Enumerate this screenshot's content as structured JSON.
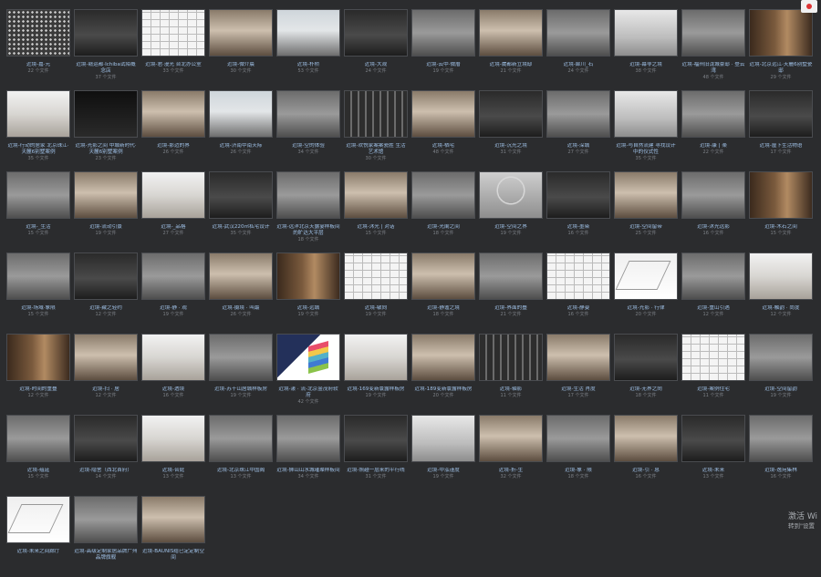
{
  "folders": [
    {
      "name": "近境-嘉·元",
      "count": "22 个文件",
      "style": "v-dots"
    },
    {
      "name": "近境-赣运都·Ichiba试陌概念店",
      "count": "37 个文件",
      "style": "v-dark"
    },
    {
      "name": "近境-君·漫光 台北办公室",
      "count": "33 个文件",
      "style": "v-plan"
    },
    {
      "name": "近境-微介晨",
      "count": "30 个文件",
      "style": "v-warm"
    },
    {
      "name": "近境-朴桥",
      "count": "53 个文件",
      "style": "v-sky"
    },
    {
      "name": "近境-大观",
      "count": "24 个文件",
      "style": "v-dark"
    },
    {
      "name": "近境-云中·微厝",
      "count": "19 个文件",
      "style": "v-grey"
    },
    {
      "name": "近境-崴都新立境邸",
      "count": "21 个文件",
      "style": "v-warm"
    },
    {
      "name": "近境-犀川_石",
      "count": "24 个文件",
      "style": "v-grey"
    },
    {
      "name": "近境-幕非之境",
      "count": "38 个文件",
      "style": "v-white"
    },
    {
      "name": "近境-福州旧泷城豪邸 · 登云湾",
      "count": "48 个文件",
      "style": "v-grey"
    },
    {
      "name": "近境-北京远江·天麓6别墅瓷邸",
      "count": "29 个文件",
      "style": "v-wood"
    },
    {
      "name": "近境-行动的居家 北京珠江·天麓6别墅案例",
      "count": "35 个文件",
      "style": "v-bright"
    },
    {
      "name": "近境-光影之间 中城新时代·天麓6别墅案例",
      "count": "23 个文件",
      "style": "v-black"
    },
    {
      "name": "近境-那边的界",
      "count": "26 个文件",
      "style": "v-warm"
    },
    {
      "name": "近境-济南中南天际",
      "count": "26 个文件",
      "style": "v-sky"
    },
    {
      "name": "近境-空的体验",
      "count": "34 个文件",
      "style": "v-grey"
    },
    {
      "name": "近境-欢悦家案案瓷胜 生活艺术馆",
      "count": "30 个文件",
      "style": "v-stripes"
    },
    {
      "name": "近境-栖宅",
      "count": "48 个文件",
      "style": "v-warm"
    },
    {
      "name": "近境-沉光之境",
      "count": "31 个文件",
      "style": "v-dark"
    },
    {
      "name": "近境-深城",
      "count": "27 个文件",
      "style": "v-grey"
    },
    {
      "name": "近境-与自然流建 寻找设计中的仪式性",
      "count": "35 个文件",
      "style": "v-white"
    },
    {
      "name": "近境-康 | 楽",
      "count": "22 个文件",
      "style": "v-grey"
    },
    {
      "name": "近境-屋下生活物语",
      "count": "17 个文件",
      "style": "v-dark"
    },
    {
      "name": "近境-_生活",
      "count": "15 个文件",
      "style": "v-grey"
    },
    {
      "name": "近境-流动引景",
      "count": "19 个文件",
      "style": "v-warm"
    },
    {
      "name": "近境-_品格",
      "count": "27 个文件",
      "style": "v-bright"
    },
    {
      "name": "近境-武汉220㎡私宅设计",
      "count": "35 个文件",
      "style": "v-dark"
    },
    {
      "name": "近境-远洋北京天露宴样板间的旷达大平层",
      "count": "18 个文件",
      "style": "v-grey"
    },
    {
      "name": "近境-沐光 | 对话",
      "count": "15 个文件",
      "style": "v-warm"
    },
    {
      "name": "近境-光阑之间",
      "count": "18 个文件",
      "style": "v-grey"
    },
    {
      "name": "近境-空间之界",
      "count": "19 个文件",
      "style": "v-circle"
    },
    {
      "name": "近境-墨染",
      "count": "16 个文件",
      "style": "v-dark"
    },
    {
      "name": "近境-空间留带",
      "count": "25 个文件",
      "style": "v-warm"
    },
    {
      "name": "近境-沐光远影",
      "count": "16 个文件",
      "style": "v-grey"
    },
    {
      "name": "近境-木石之间",
      "count": "15 个文件",
      "style": "v-wood"
    },
    {
      "name": "近境-场域·象限",
      "count": "15 个文件",
      "style": "v-grey"
    },
    {
      "name": "近境-藏之轻约",
      "count": "12 个文件",
      "style": "v-dark"
    },
    {
      "name": "近境-静 · 观",
      "count": "19 个文件",
      "style": "v-grey"
    },
    {
      "name": "近境-摄境 · 叫最",
      "count": "26 个文件",
      "style": "v-warm"
    },
    {
      "name": "近境-远城",
      "count": "19 个文件",
      "style": "v-wood"
    },
    {
      "name": "近境-敏向",
      "count": "19 个文件",
      "style": "v-plan"
    },
    {
      "name": "近境-静谧之境",
      "count": "18 个文件",
      "style": "v-warm"
    },
    {
      "name": "近境-界面的叠",
      "count": "21 个文件",
      "style": "v-grey"
    },
    {
      "name": "近境-静姿",
      "count": "16 个文件",
      "style": "v-plan"
    },
    {
      "name": "近境-光影 · 行律",
      "count": "20 个文件",
      "style": "v-line"
    },
    {
      "name": "近境-重山引遇",
      "count": "12 个文件",
      "style": "v-grey"
    },
    {
      "name": "近境-触韵 · 尚度",
      "count": "12 个文件",
      "style": "v-bright"
    },
    {
      "name": "近境-时间的重叠",
      "count": "12 个文件",
      "style": "v-wood"
    },
    {
      "name": "近境-扫 · 居",
      "count": "12 个文件",
      "style": "v-warm"
    },
    {
      "name": "近境-透境",
      "count": "16 个文件",
      "style": "v-bright"
    },
    {
      "name": "近境-苏十山居城样板房",
      "count": "19 个文件",
      "style": "v-grey"
    },
    {
      "name": "近境-漾 · 流-北京金茂府软府",
      "count": "42 个文件",
      "style": "v-color"
    },
    {
      "name": "近境-169变新寰露样板房",
      "count": "19 个文件",
      "style": "v-bright"
    },
    {
      "name": "近境-189变新寰露样板房",
      "count": "20 个文件",
      "style": "v-warm"
    },
    {
      "name": "近境-轴影",
      "count": "11 个文件",
      "style": "v-stripes"
    },
    {
      "name": "近境-生活 肖度",
      "count": "17 个文件",
      "style": "v-warm"
    },
    {
      "name": "近境-无界之向",
      "count": "18 个文件",
      "style": "v-dark"
    },
    {
      "name": "近境-案例住宅",
      "count": "11 个文件",
      "style": "v-plan"
    },
    {
      "name": "近境-空间留韵",
      "count": "19 个文件",
      "style": "v-grey"
    },
    {
      "name": "近境-蕴延",
      "count": "15 个文件",
      "style": "v-grey"
    },
    {
      "name": "近境-隐舍（西北首府）",
      "count": "14 个文件",
      "style": "v-dark"
    },
    {
      "name": "近境-合庭",
      "count": "13 个文件",
      "style": "v-bright"
    },
    {
      "name": "近境-北京珠江中国阁",
      "count": "13 个文件",
      "style": "v-grey"
    },
    {
      "name": "近境-狮山山水城璀璨样板间",
      "count": "34 个文件",
      "style": "v-grey"
    },
    {
      "name": "近境-照越一层来的平行线",
      "count": "31 个文件",
      "style": "v-dark"
    },
    {
      "name": "近境-中泓谨度",
      "count": "19 个文件",
      "style": "v-white"
    },
    {
      "name": "近境-折-生",
      "count": "32 个文件",
      "style": "v-warm"
    },
    {
      "name": "近境-象 · 限",
      "count": "18 个文件",
      "style": "v-grey"
    },
    {
      "name": "近境-引 · 息",
      "count": "16 个文件",
      "style": "v-warm"
    },
    {
      "name": "近境-未来",
      "count": "13 个文件",
      "style": "v-dark"
    },
    {
      "name": "近境-逸宛集林",
      "count": "16 个文件",
      "style": "v-grey"
    },
    {
      "name": "近境-未来之间廊厅",
      "count": "",
      "style": "v-line"
    },
    {
      "name": "近境-高级定制家居品牌广州品牌旗舰",
      "count": "",
      "style": "v-grey"
    },
    {
      "name": "近境-BAUNIS给已定定制空间",
      "count": "",
      "style": "v-warm"
    }
  ],
  "overlay": {
    "icon": "app-icon"
  },
  "activation": {
    "line1": "激活 Wi",
    "line2": "转到\"设置"
  }
}
